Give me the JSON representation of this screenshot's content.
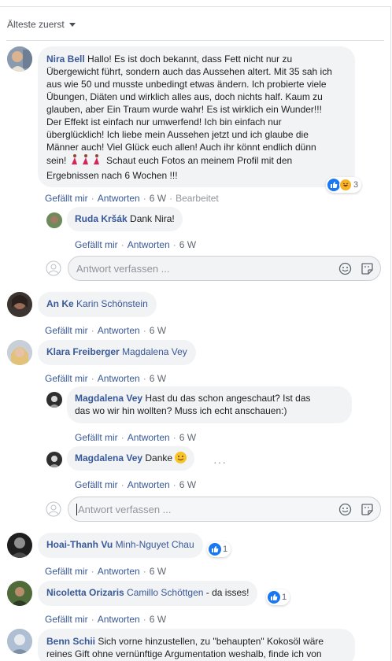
{
  "sort": {
    "label": "Älteste zuerst"
  },
  "actions": {
    "like": "Gefällt mir",
    "reply": "Antworten",
    "edited": "Bearbeitet"
  },
  "reply_box": {
    "placeholder": "Antwort verfassen ..."
  },
  "comments": [
    {
      "author": "Nira Bell",
      "text_lines": [
        "Hallo! Es ist doch bekannt, dass Fett nicht nur zu",
        "Übergewicht führt, sondern auch das Aussehen altert. Mit 35 sah ich",
        "aus wie 50 und musste unbedingt etwas ändern. Ich probierte viele",
        "Übungen, Diäten und wirklich alles aus, doch nichts half. Kaum zu",
        "glauben, aber Ein Traum wurde wahr! Es ist wirklich ein Wunder!!!",
        "Der Effekt ist einfach nur umwerfend! Ich bin einfach nur",
        "überglücklich! Ich liebe mein Aussehen jetzt und ich glaube die",
        "Männer auch! Viel Glück euch allen! Auch ihr könnt endlich dünn",
        "sein!",
        "Schaut euch Fotos an meinem Profil mit den",
        "Ergebnissen nach 6 Wochen !!!"
      ],
      "time": "6 W",
      "reaction_count": "3"
    },
    {
      "author": "Ruda Kršák",
      "text": "Dank Nira!",
      "time": "6 W"
    },
    {
      "author": "An Ke",
      "tag": "Karin Schönstein",
      "time": "6 W"
    },
    {
      "author": "Klara Freiberger",
      "tag": "Magdalena Vey",
      "time": "6 W"
    },
    {
      "author": "Magdalena Vey",
      "text_lines": [
        "Hast du das schon angeschaut? Ist das",
        "das wo wir hin wollten? Muss ich echt anschauen:)"
      ],
      "time": "6 W"
    },
    {
      "author": "Magdalena Vey",
      "text": "Danke",
      "time": "6 W"
    },
    {
      "author": "Hoai-Thanh Vu",
      "tag": "Minh-Nguyet Chau",
      "time": "6 W",
      "reaction_count": "1"
    },
    {
      "author": "Nicoletta Orizaris",
      "tag": "Camillo Schöttgen",
      "text": " - da isses!",
      "time": "6 W",
      "reaction_count": "1"
    },
    {
      "author": "Benn Schii",
      "text_lines": [
        "Sich vorne hinzustellen, zu \"behaupten\" Kokosöl wäre",
        "reines Gift ohne vernünftige Argumentation weshalb, finde ich von"
      ]
    }
  ],
  "colors": {
    "link": "#385898",
    "bubble": "#f2f3f5",
    "meta": "#606770",
    "like": "#1877f2"
  }
}
